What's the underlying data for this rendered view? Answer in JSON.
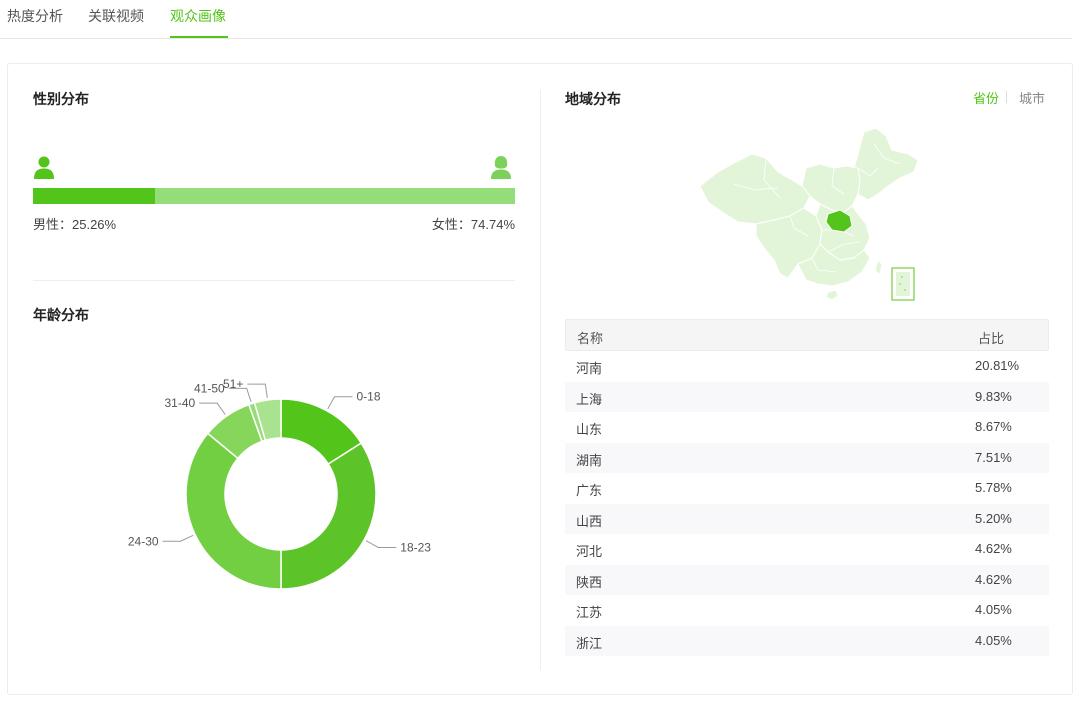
{
  "tabs": [
    {
      "label": "热度分析",
      "active": false
    },
    {
      "label": "关联视频",
      "active": false
    },
    {
      "label": "观众画像",
      "active": true
    }
  ],
  "gender": {
    "title": "性别分布",
    "male_label": "男性：25.26%",
    "female_label": "女性：74.74%",
    "male_pct": 25.26,
    "female_pct": 74.74,
    "male_color": "#52c41a",
    "female_color": "#95dd79",
    "male_icon": "male-user-icon",
    "female_icon": "female-user-icon"
  },
  "age": {
    "title": "年龄分布"
  },
  "chart_data": {
    "type": "pie",
    "donut": true,
    "categories": [
      "0-18",
      "18-23",
      "24-30",
      "31-40",
      "41-50",
      "51+"
    ],
    "values": [
      16,
      34,
      36,
      8.5,
      1,
      4.5
    ],
    "colors": [
      "#52c41a",
      "#5cc428",
      "#72cf42",
      "#86d65c",
      "#98dc7a",
      "#a9e38f"
    ]
  },
  "region": {
    "title": "地域分布",
    "switch_province": "省份",
    "switch_city": "城市",
    "active_switch": "省份",
    "highlighted_province": "河南",
    "map_base_color": "#e3f5d8",
    "map_highlight_color": "#52c41a",
    "table": {
      "header_name": "名称",
      "header_pct": "占比",
      "rows": [
        {
          "name": "河南",
          "pct": "20.81%"
        },
        {
          "name": "上海",
          "pct": "9.83%"
        },
        {
          "name": "山东",
          "pct": "8.67%"
        },
        {
          "name": "湖南",
          "pct": "7.51%"
        },
        {
          "name": "广东",
          "pct": "5.78%"
        },
        {
          "name": "山西",
          "pct": "5.20%"
        },
        {
          "name": "河北",
          "pct": "4.62%"
        },
        {
          "name": "陕西",
          "pct": "4.62%"
        },
        {
          "name": "江苏",
          "pct": "4.05%"
        },
        {
          "name": "浙江",
          "pct": "4.05%"
        }
      ]
    }
  }
}
